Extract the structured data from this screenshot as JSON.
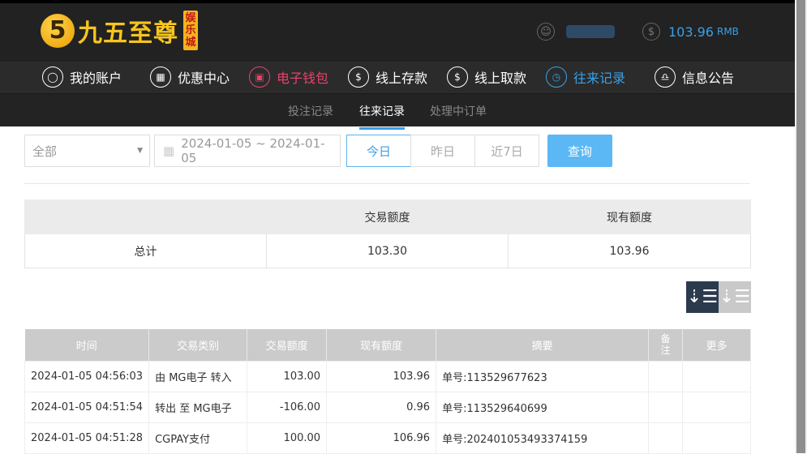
{
  "header": {
    "logo_mark": "5",
    "logo_text": "九五至尊",
    "logo_badge": "娱乐城",
    "balance": "103.96",
    "currency": "RMB"
  },
  "nav": [
    {
      "label": "我的账户",
      "icon": "user-icon"
    },
    {
      "label": "优惠中心",
      "icon": "gift-icon"
    },
    {
      "label": "电子钱包",
      "icon": "wallet-icon"
    },
    {
      "label": "线上存款",
      "icon": "deposit-icon"
    },
    {
      "label": "线上取款",
      "icon": "withdraw-icon"
    },
    {
      "label": "往来记录",
      "icon": "records-icon"
    },
    {
      "label": "信息公告",
      "icon": "bell-icon"
    }
  ],
  "subnav": [
    "投注记录",
    "往来记录",
    "处理中订单"
  ],
  "filter": {
    "type": "全部",
    "date_range": "2024-01-05 ~ 2024-01-05",
    "today": "今日",
    "yesterday": "昨日",
    "last7": "近7日",
    "query": "查询"
  },
  "summary": {
    "headers": [
      "",
      "交易额度",
      "现有额度"
    ],
    "label": "总计",
    "trade": "103.30",
    "current": "103.96"
  },
  "table": {
    "headers": [
      "时间",
      "交易类别",
      "交易额度",
      "现有额度",
      "摘要",
      "备注",
      "更多"
    ],
    "rows": [
      [
        "2024-01-05 04:56:03",
        "由 MG电子 转入",
        "103.00",
        "103.96",
        "单号:113529677623",
        "",
        ""
      ],
      [
        "2024-01-05 04:51:54",
        "转出 至 MG电子",
        "-106.00",
        "0.96",
        "单号:113529640699",
        "",
        ""
      ],
      [
        "2024-01-05 04:51:28",
        "CGPAY支付",
        "100.00",
        "106.96",
        "单号:202401053493374159",
        "",
        ""
      ]
    ]
  },
  "colors": {
    "accent": "#3aa0e8",
    "wallet": "#e8436c",
    "query_button": "#5bb8f5"
  }
}
